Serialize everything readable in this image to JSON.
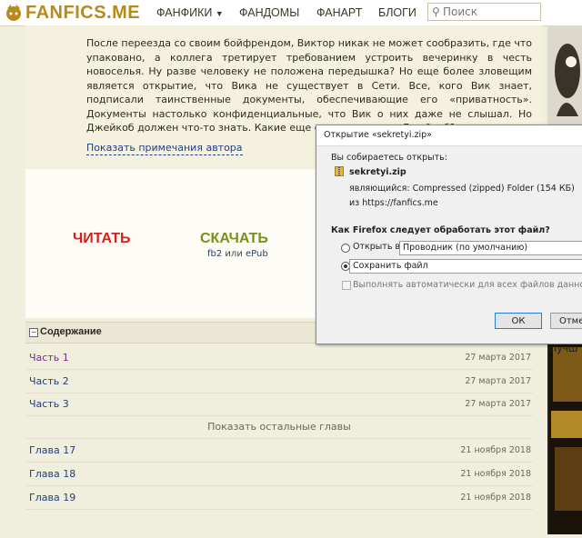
{
  "nav": {
    "logo": "FANFICS.ME",
    "items": [
      "ФАНФИКИ",
      "ФАНДОМЫ",
      "ФАНАРТ",
      "БЛОГИ"
    ],
    "search_placeholder": "Поиск"
  },
  "summary": {
    "text": "После переезда со своим бойфрендом, Виктор никак не может сообразить, где что упаковано, а коллега третирует требованием устроить вечеринку в честь новоселья. Ну разве человеку не положена передышка? Но еще более зловещим является открытие, что Вика не существует в Сети. Все, кого Вик знает, подписали таинственные документы, обеспечивающие его «приватность». Документы настолько конфиденциальные, что Вик о них даже не слышал. Но Джейкоб должен что-то знать. Какие еще секреты хранит Джейкоб?",
    "author_notes": "Показать примечания автора"
  },
  "actions": {
    "read": "ЧИТАТЬ",
    "download": "СКАЧАТЬ",
    "fb2": "fb2",
    "or": "или",
    "epub": "ePub"
  },
  "toc": {
    "title": "Содержание",
    "rows_top": [
      {
        "label": "Часть 1",
        "date": "27 марта 2017",
        "visited": true
      },
      {
        "label": "Часть 2",
        "date": "27 марта 2017",
        "visited": false
      },
      {
        "label": "Часть 3",
        "date": "27 марта 2017",
        "visited": false
      }
    ],
    "show_more": "Показать остальные главы",
    "rows_bottom": [
      {
        "label": "Глава 17",
        "date": "21 ноября 2018"
      },
      {
        "label": "Глава 18",
        "date": "21 ноября 2018"
      },
      {
        "label": "Глава 19",
        "date": "21 ноября 2018"
      }
    ]
  },
  "sidebar": {
    "label": "Лучш"
  },
  "dialog": {
    "title": "Открытие «sekretyi.zip»",
    "opening_label": "Вы собираетесь открыть:",
    "filename": "sekretyi.zip",
    "type_label": "являющийся:",
    "type_value": "Compressed (zipped) Folder (154 КБ)",
    "from_label": "из",
    "from_value": "https://fanfics.me",
    "question": "Как Firefox следует обработать этот файл?",
    "open_with_label": "Открыть в",
    "open_with_value": "Проводник (по умолчанию)",
    "save_label": "Сохранить файл",
    "auto_label": "Выполнять автоматически для всех файлов данного типа.",
    "ok": "ОК",
    "cancel": "Отмена"
  }
}
